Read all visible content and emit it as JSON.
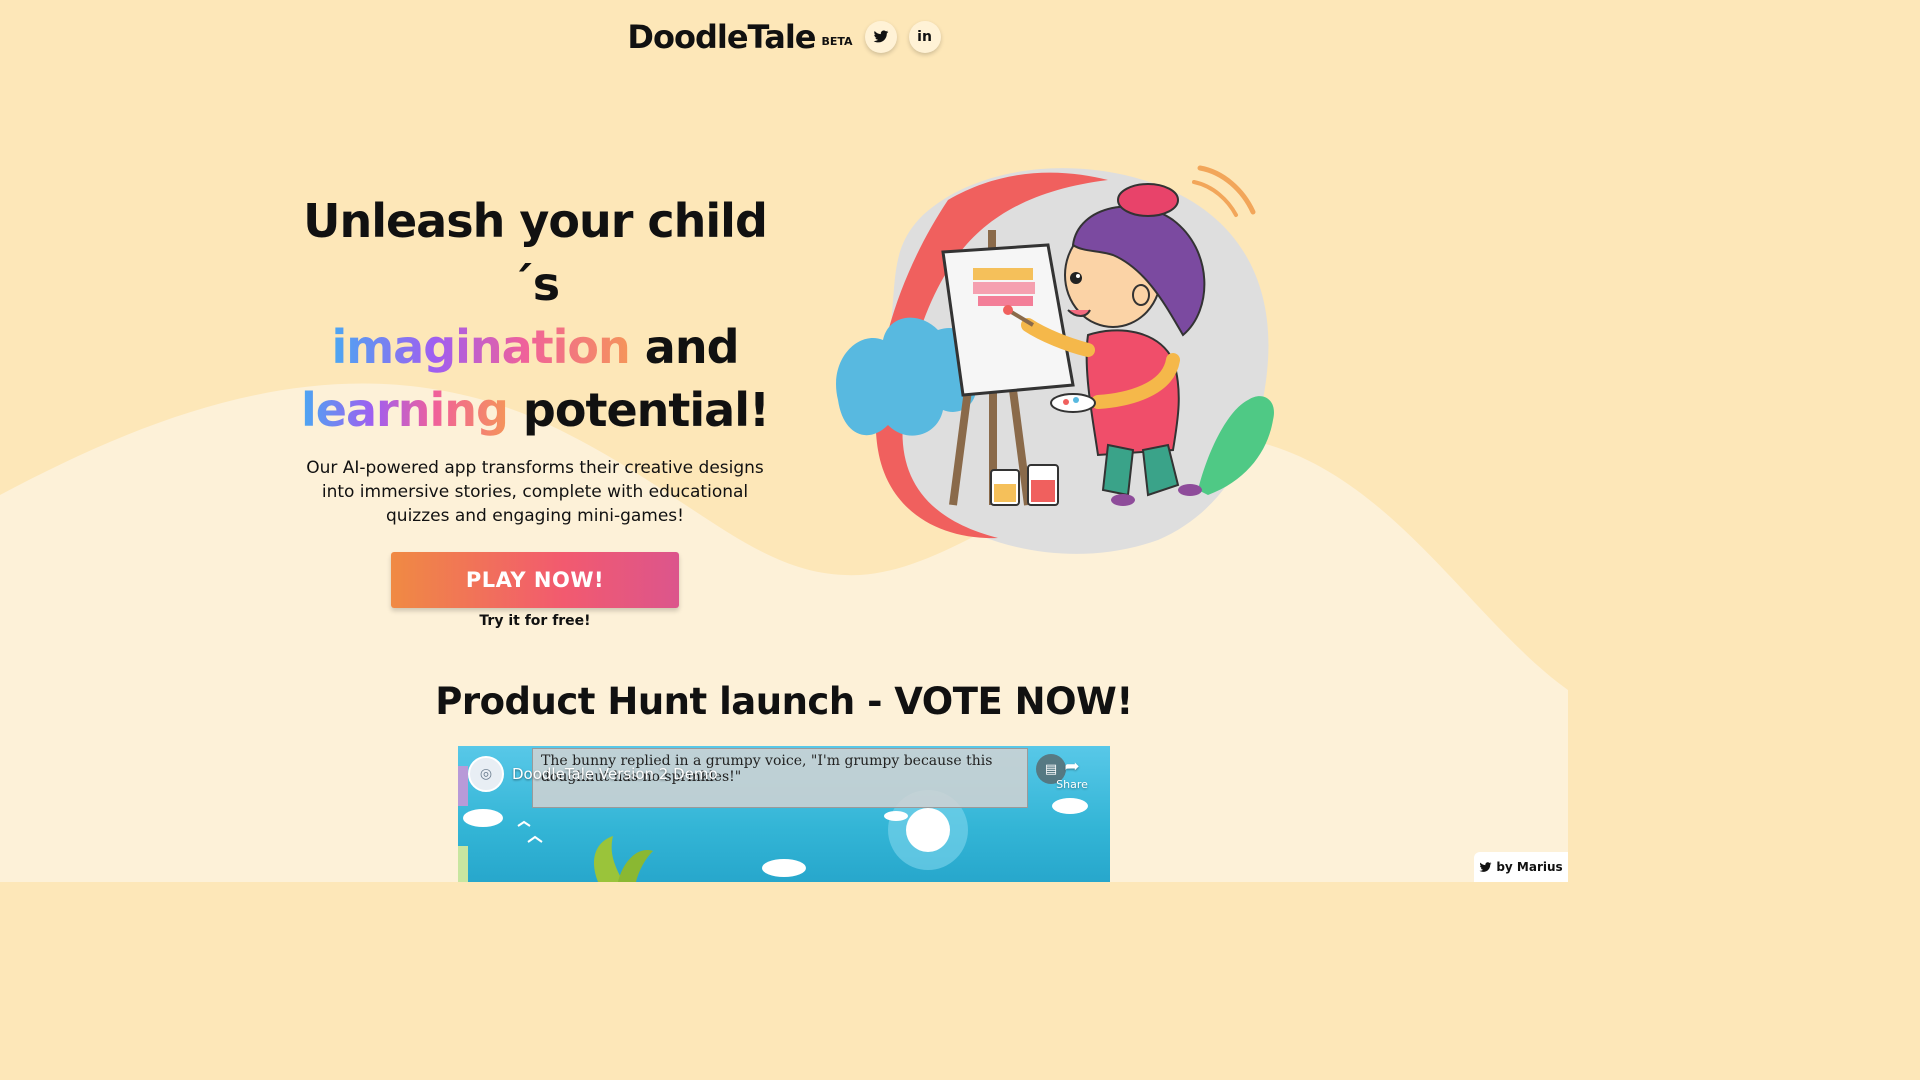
{
  "header": {
    "logo": "DoodleTale",
    "beta": "BETA",
    "social": [
      {
        "icon": "twitter-icon",
        "glyph": "🐦"
      },
      {
        "icon": "linkedin-icon",
        "glyph": "in"
      }
    ]
  },
  "hero": {
    "headline_line1": "Unleash your child´s",
    "headline_imagination": "imagination",
    "headline_and": " and",
    "headline_learning": "learning",
    "headline_potential": " potential!",
    "subtext": "Our AI-powered app transforms their creative designs into immersive stories, complete with educational quizzes and engaging mini-games!",
    "cta_label": "PLAY NOW!",
    "cta_note": "Try it for free!",
    "illustration": "child-painting-at-easel-illustration"
  },
  "section": {
    "title": "Product Hunt launch - VOTE NOW!"
  },
  "video": {
    "caption": "The bunny replied in a grumpy voice, \"I'm grumpy because this doughnut has no sprinkles!\"",
    "title": "DoodleTale Version 2 Demo",
    "share_label": "Share"
  },
  "badge": {
    "label": "by Marius",
    "icon": "twitter-icon"
  },
  "colors": {
    "background": "#fde7b8",
    "background_light": "#fdf1d8",
    "gradient_text": [
      "#4aa8f2",
      "#a05ef0",
      "#f0619a",
      "#f5955a"
    ],
    "cta_gradient": [
      "#f08a43",
      "#f25a6f",
      "#dc558c"
    ]
  }
}
